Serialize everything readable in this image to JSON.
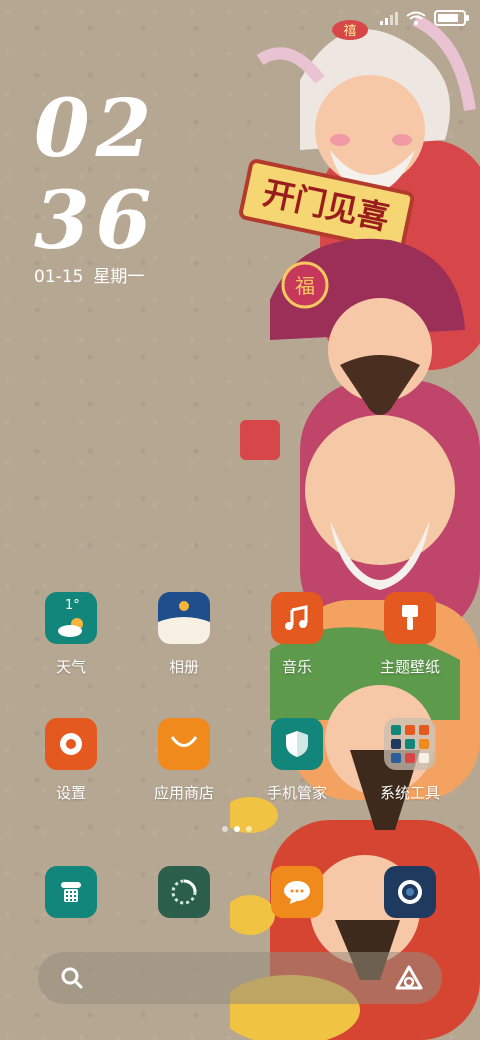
{
  "clock": {
    "hour": "02",
    "minute": "36"
  },
  "date": {
    "day": "01-15",
    "weekday": "星期一"
  },
  "wallpaper": {
    "banner_text": "开门见喜",
    "hat_text": "福",
    "badge_text": "禧"
  },
  "weather_widget": {
    "temperature": "1°"
  },
  "apps_row1": [
    {
      "label": "天气",
      "icon": "weather-icon",
      "color": "#12867a"
    },
    {
      "label": "相册",
      "icon": "gallery-icon",
      "color": "#1f4e8c"
    },
    {
      "label": "音乐",
      "icon": "music-icon",
      "color": "#e4591f"
    },
    {
      "label": "主题壁纸",
      "icon": "theme-brush-icon",
      "color": "#e4591f"
    }
  ],
  "apps_row2": [
    {
      "label": "设置",
      "icon": "settings-icon",
      "color": "#e4591f"
    },
    {
      "label": "应用商店",
      "icon": "app-store-bag-icon",
      "color": "#f08a1c"
    },
    {
      "label": "手机管家",
      "icon": "shield-icon",
      "color": "#12867a"
    },
    {
      "label": "系统工具",
      "icon": "folder-icon",
      "color": "#b9ae9c"
    }
  ],
  "dock": [
    {
      "icon": "phone-icon",
      "color": "#12867a"
    },
    {
      "icon": "browser-icon",
      "color": "#2c5e4c"
    },
    {
      "icon": "messages-icon",
      "color": "#f08a1c"
    },
    {
      "icon": "camera-icon",
      "color": "#1e3a5f"
    }
  ]
}
